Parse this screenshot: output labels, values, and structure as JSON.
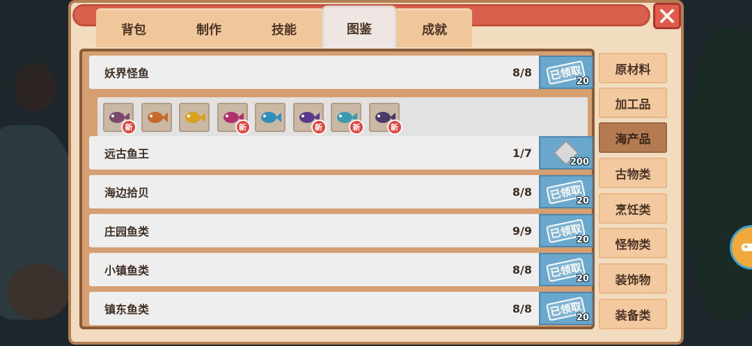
{
  "tabs": [
    {
      "label": "背包",
      "active": false
    },
    {
      "label": "制作",
      "active": false
    },
    {
      "label": "技能",
      "active": false
    },
    {
      "label": "图鉴",
      "active": true
    },
    {
      "label": "成就",
      "active": false
    }
  ],
  "close_icon": "close-icon",
  "rows": [
    {
      "name": "妖界怪鱼",
      "count": "8/8",
      "reward_stamp": "已领取",
      "reward_qty": "20",
      "reward_icon": "claimed-stamp-icon",
      "expanded": true
    },
    {
      "name": "远古鱼王",
      "count": "1/7",
      "reward_stamp": "",
      "reward_qty": "200",
      "reward_icon": "silver-chest-icon",
      "expanded": false
    },
    {
      "name": "海边拾贝",
      "count": "8/8",
      "reward_stamp": "已领取",
      "reward_qty": "20",
      "reward_icon": "claimed-stamp-icon",
      "expanded": false
    },
    {
      "name": "庄园鱼类",
      "count": "9/9",
      "reward_stamp": "已领取",
      "reward_qty": "20",
      "reward_icon": "claimed-stamp-icon",
      "expanded": false
    },
    {
      "name": "小镇鱼类",
      "count": "8/8",
      "reward_stamp": "已领取",
      "reward_qty": "20",
      "reward_icon": "claimed-stamp-icon",
      "expanded": false
    },
    {
      "name": "镇东鱼类",
      "count": "8/8",
      "reward_stamp": "已领取",
      "reward_qty": "20",
      "reward_icon": "claimed-stamp-icon",
      "expanded": false
    }
  ],
  "fish": [
    {
      "icon": "purple-fish-icon",
      "color": "#7a4a6e",
      "new": true
    },
    {
      "icon": "orange-fish-icon",
      "color": "#c56a2a",
      "new": false
    },
    {
      "icon": "yellow-fish-icon",
      "color": "#d9a21e",
      "new": false
    },
    {
      "icon": "magenta-fish-icon",
      "color": "#b0306e",
      "new": true
    },
    {
      "icon": "blue-fish-icon",
      "color": "#2f8fb8",
      "new": false
    },
    {
      "icon": "violet-fish-icon",
      "color": "#5a3a8a",
      "new": true
    },
    {
      "icon": "teal-fish-icon",
      "color": "#3a9ab0",
      "new": true
    },
    {
      "icon": "indigo-fish-icon",
      "color": "#4a3a6a",
      "new": true
    }
  ],
  "new_badge_label": "新",
  "categories": [
    {
      "label": "原材料",
      "active": false
    },
    {
      "label": "加工品",
      "active": false
    },
    {
      "label": "海产品",
      "active": true
    },
    {
      "label": "古物类",
      "active": false
    },
    {
      "label": "烹饪类",
      "active": false
    },
    {
      "label": "怪物类",
      "active": false
    },
    {
      "label": "装饰物",
      "active": false
    },
    {
      "label": "装备类",
      "active": false
    }
  ],
  "side_button_icon": "gamepad-icon",
  "colors": {
    "accent_red": "#d8614d",
    "panel_brown": "#d59f71",
    "claimed_blue": "#6aa7cc",
    "active_category": "#b47b52"
  }
}
